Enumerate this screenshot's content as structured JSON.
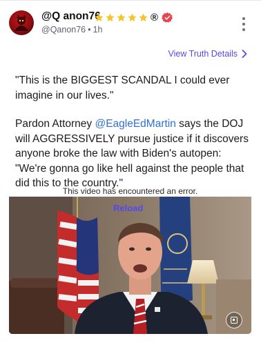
{
  "post": {
    "display_name": "@Q anon76",
    "badge_stars": 5,
    "registered_mark": "®",
    "handle": "@Qanon76",
    "separator": "•",
    "timestamp": "1h",
    "view_details_label": "View Truth Details"
  },
  "media": {
    "quote_line_1": "\"This is the BIGGEST SCANDAL I could ever imagine in our lives.\"",
    "quote_para_2_before": "Pardon Attorney ",
    "quote_mention": "@EagleEdMartin",
    "quote_para_2_after": " says the DOJ will AGGRESSIVELY pursue justice if it discovers anyone broke the law with Biden's autopen: \"We're gonna go like hell against the people that did this to the country.\"",
    "error_message": "This video has encountered an error.",
    "reload_label": "Reload"
  },
  "colors": {
    "accent": "#5448ee",
    "mention": "#2f6fd6",
    "star": "#f5c42c",
    "verified": "#e8434f"
  }
}
